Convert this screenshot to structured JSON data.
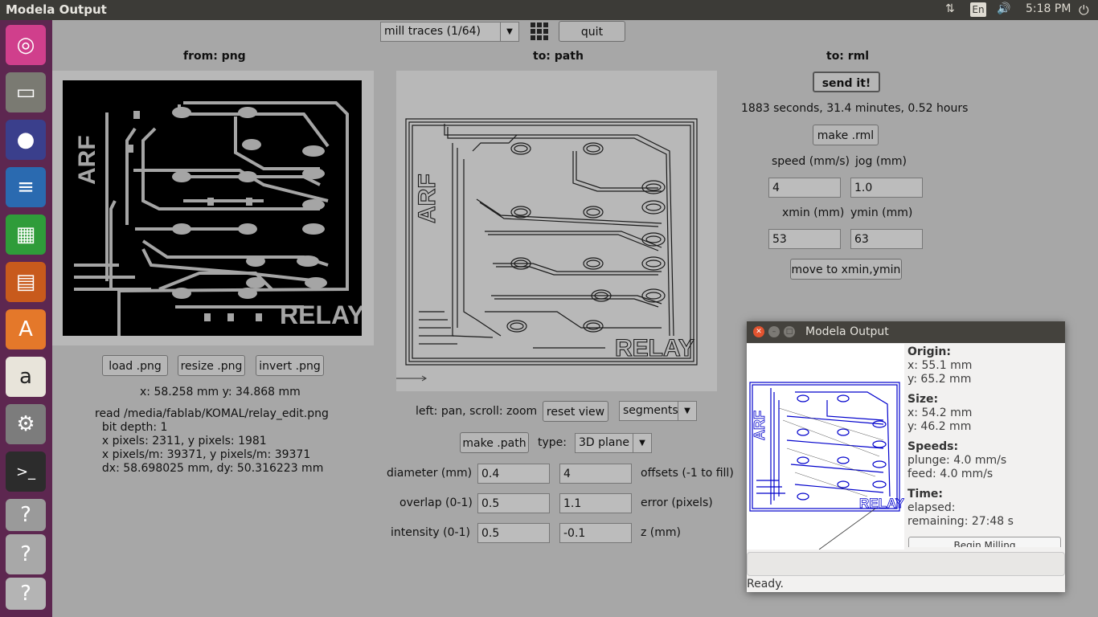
{
  "topbar": {
    "title": "Modela Output",
    "lang": "En",
    "time": "5:18 PM"
  },
  "launcher": {
    "icons": [
      "ubuntu-icon",
      "files-icon",
      "firefox-icon",
      "writer-icon",
      "calc-icon",
      "impress-icon",
      "software-icon",
      "amazon-icon",
      "settings-icon",
      "terminal-icon",
      "unknown-app-icon",
      "unknown-app-icon",
      "unknown-app-icon"
    ]
  },
  "toolbar": {
    "mode": "mill traces (1/64)",
    "quit": "quit"
  },
  "left": {
    "header": "from: png",
    "load": "load .png",
    "resize": "resize .png",
    "invert": "invert .png",
    "coords": "x: 58.258 mm  y: 34.868 mm",
    "info": "read /media/fablab/KOMAL/relay_edit.png\n  bit depth: 1\n  x pixels: 2311, y pixels: 1981\n  x pixels/m: 39371, y pixels/m: 39371\n  dx: 58.698025 mm, dy: 50.316223 mm",
    "board_text_arf": "ARF",
    "board_text_relay": "RELAY"
  },
  "middle": {
    "header": "to: path",
    "hint": "left: pan, scroll: zoom",
    "reset": "reset view",
    "segments": "segments",
    "make_path": "make .path",
    "type_label": "type:",
    "type_value": "3D plane",
    "diameter_label": "diameter (mm)",
    "diameter": "0.4",
    "offsets": "4",
    "offsets_label": "offsets (-1 to fill)",
    "overlap_label": "overlap (0-1)",
    "overlap": "0.5",
    "error": "1.1",
    "error_label": "error (pixels)",
    "intensity_label": "intensity (0-1)",
    "intensity": "0.5",
    "z": "-0.1",
    "z_label": "z (mm)"
  },
  "right": {
    "header": "to: rml",
    "send": "send it!",
    "time_estimate": "1883 seconds, 31.4 minutes, 0.52 hours",
    "make_rml": "make .rml",
    "speed_label": "speed (mm/s)",
    "jog_label": "jog (mm)",
    "speed": "4",
    "jog": "1.0",
    "xmin_label": "xmin (mm)",
    "ymin_label": "ymin (mm)",
    "xmin": "53",
    "ymin": "63",
    "move": "move to xmin,ymin"
  },
  "popup": {
    "title": "Modela Output",
    "origin_h": "Origin:",
    "origin_x": "x: 55.1 mm",
    "origin_y": "y: 65.2 mm",
    "size_h": "Size:",
    "size_x": "x: 54.2 mm",
    "size_y": "y: 46.2 mm",
    "speeds_h": "Speeds:",
    "plunge": "plunge: 4.0 mm/s",
    "feed": "feed: 4.0 mm/s",
    "time_h": "Time:",
    "elapsed": "elapsed:",
    "remaining": "remaining: 27:48 s",
    "begin": "Begin Milling",
    "status": "Ready."
  }
}
